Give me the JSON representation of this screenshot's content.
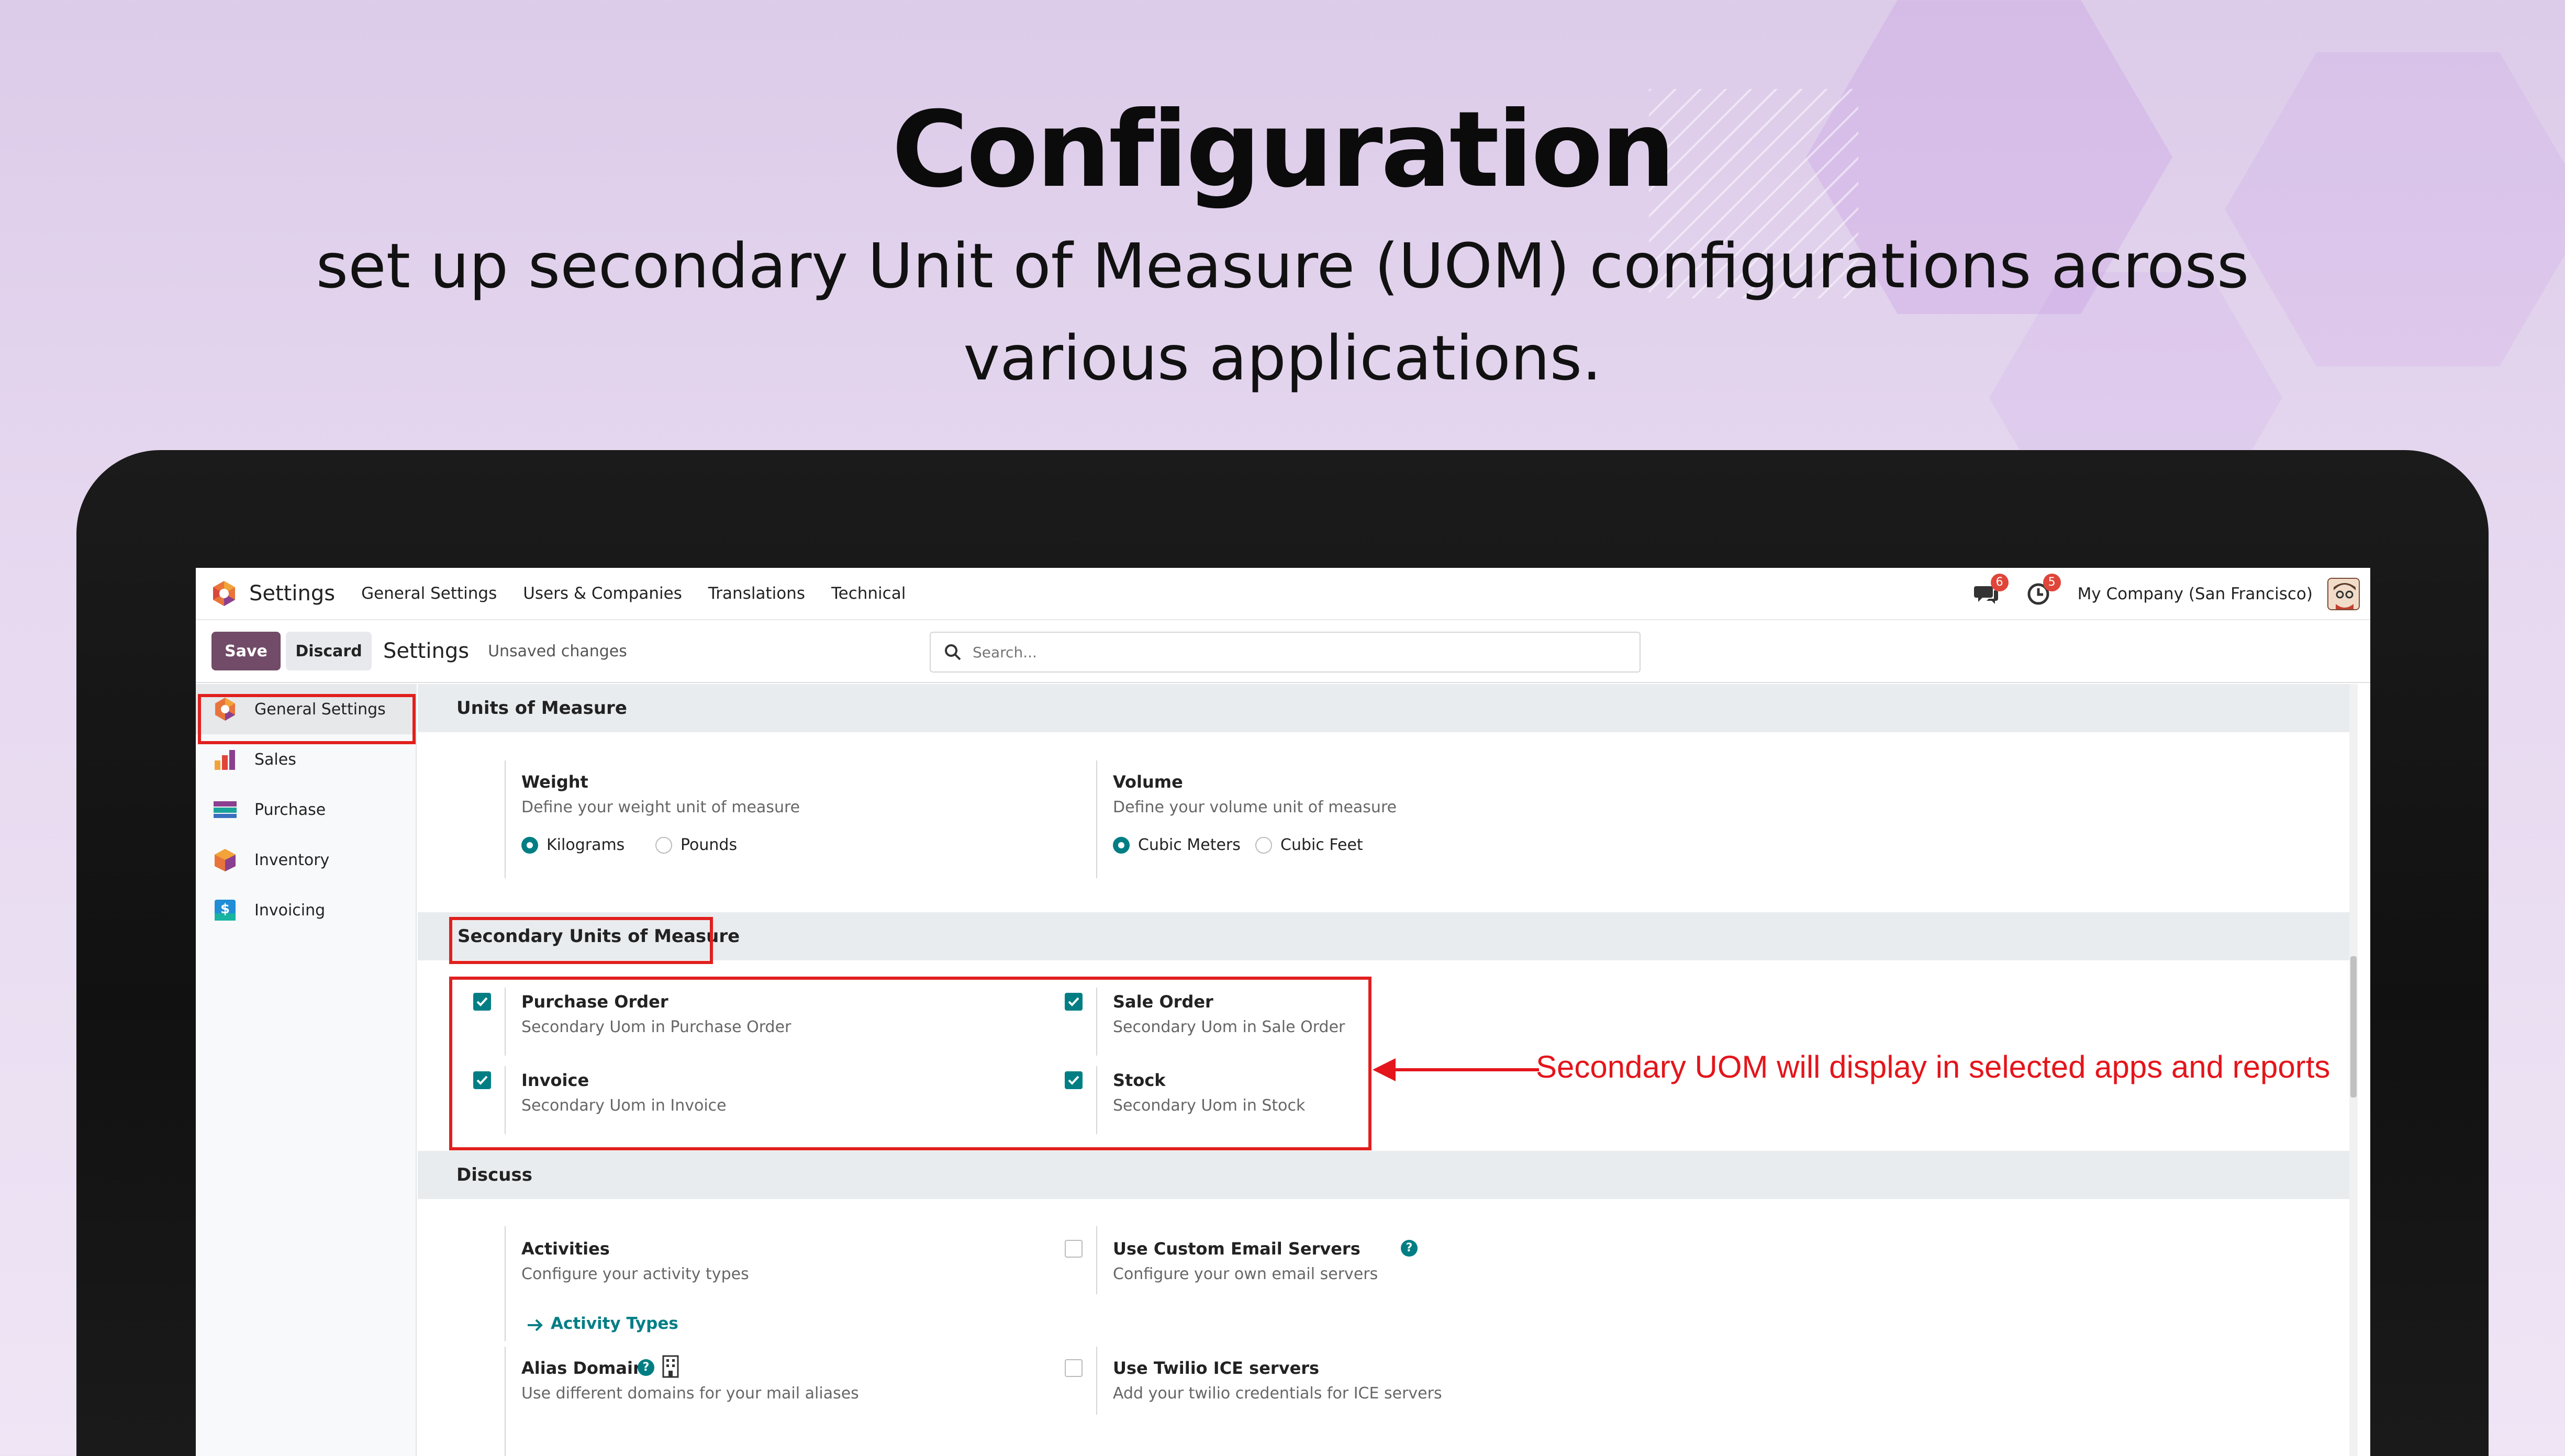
{
  "promo": {
    "title": "Configuration",
    "subtitle": "set up secondary Unit of Measure (UOM) configurations across various applications."
  },
  "topnav": {
    "app_name": "Settings",
    "items": [
      "General Settings",
      "Users & Companies",
      "Translations",
      "Technical"
    ],
    "messages_badge": "6",
    "activity_badge": "5",
    "company": "My Company (San Francisco)"
  },
  "control": {
    "save_label": "Save",
    "discard_label": "Discard",
    "title": "Settings",
    "status": "Unsaved changes",
    "search_placeholder": "Search..."
  },
  "sidebar": {
    "items": [
      {
        "label": "General Settings",
        "icon": "settings-app-icon"
      },
      {
        "label": "Sales",
        "icon": "sales-app-icon"
      },
      {
        "label": "Purchase",
        "icon": "purchase-app-icon"
      },
      {
        "label": "Inventory",
        "icon": "inventory-app-icon"
      },
      {
        "label": "Invoicing",
        "icon": "invoicing-app-icon"
      }
    ]
  },
  "units_of_measure": {
    "heading": "Units of Measure",
    "weight": {
      "title": "Weight",
      "desc": "Define your weight unit of measure",
      "opt1": "Kilograms",
      "opt2": "Pounds",
      "selected": "Kilograms"
    },
    "volume": {
      "title": "Volume",
      "desc": "Define your volume unit of measure",
      "opt1": "Cubic Meters",
      "opt2": "Cubic Feet",
      "selected": "Cubic Meters"
    }
  },
  "secondary_uom": {
    "heading": "Secondary Units of Measure",
    "purchase": {
      "title": "Purchase Order",
      "desc": "Secondary Uom in Purchase Order",
      "checked": true
    },
    "sale": {
      "title": "Sale Order",
      "desc": "Secondary Uom in Sale Order",
      "checked": true
    },
    "invoice": {
      "title": "Invoice",
      "desc": "Secondary Uom in Invoice",
      "checked": true
    },
    "stock": {
      "title": "Stock",
      "desc": "Secondary Uom in Stock",
      "checked": true
    }
  },
  "discuss": {
    "heading": "Discuss",
    "activities": {
      "title": "Activities",
      "desc": "Configure your activity types",
      "link": "Activity Types"
    },
    "email_servers": {
      "title": "Use Custom Email Servers",
      "desc": "Configure your own email servers",
      "checked": false
    },
    "alias": {
      "title": "Alias Domain",
      "desc": "Use different domains for your mail aliases"
    },
    "twilio": {
      "title": "Use Twilio ICE servers",
      "desc": "Add your twilio credentials for ICE servers",
      "checked": false
    }
  },
  "annotation": "Secondary UOM will display in selected apps and reports",
  "colors": {
    "brand": "#714b67",
    "accent": "#017e84",
    "highlight": "#e0201e",
    "badge": "#e0453a"
  }
}
